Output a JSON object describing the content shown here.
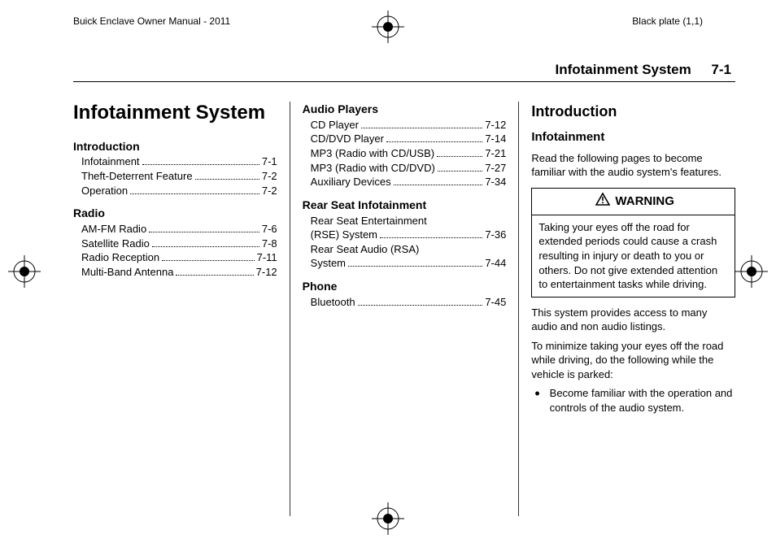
{
  "header": {
    "manual": "Buick Enclave Owner Manual - 2011",
    "plate": "Black plate (1,1)"
  },
  "section_header": {
    "title": "Infotainment System",
    "num": "7-1"
  },
  "chapter_title": "Infotainment System",
  "toc_col1": [
    {
      "title": "Introduction",
      "items": [
        {
          "label": "Infotainment",
          "page": "7-1"
        },
        {
          "label": "Theft-Deterrent Feature",
          "page": "7-2"
        },
        {
          "label": "Operation",
          "page": "7-2"
        }
      ]
    },
    {
      "title": "Radio",
      "items": [
        {
          "label": "AM-FM Radio",
          "page": "7-6"
        },
        {
          "label": "Satellite Radio",
          "page": "7-8"
        },
        {
          "label": "Radio Reception",
          "page": "7-11"
        },
        {
          "label": "Multi-Band Antenna",
          "page": "7-12"
        }
      ]
    }
  ],
  "toc_col2": [
    {
      "title": "Audio Players",
      "items": [
        {
          "label": "CD Player",
          "page": "7-12"
        },
        {
          "label": "CD/DVD Player",
          "page": "7-14"
        },
        {
          "label": "MP3 (Radio with CD/USB)",
          "page": "7-21"
        },
        {
          "label": "MP3 (Radio with CD/DVD)",
          "page": "7-27"
        },
        {
          "label": "Auxiliary Devices",
          "page": "7-34"
        }
      ]
    },
    {
      "title": "Rear Seat Infotainment",
      "items": [
        {
          "label": "Rear Seat Entertainment (RSE) System",
          "page": "7-36",
          "multiline": true
        },
        {
          "label": "Rear Seat Audio (RSA) System",
          "page": "7-44",
          "multiline": true
        }
      ]
    },
    {
      "title": "Phone",
      "items": [
        {
          "label": "Bluetooth",
          "page": "7-45"
        }
      ]
    }
  ],
  "intro": {
    "heading": "Introduction",
    "subheading": "Infotainment",
    "lead": "Read the following pages to become familiar with the audio system's features.",
    "warning_label": "WARNING",
    "warning_body": "Taking your eyes off the road for extended periods could cause a crash resulting in injury or death to you or others. Do not give extended attention to entertainment tasks while driving.",
    "para2": "This system provides access to many audio and non audio listings.",
    "para3": "To minimize taking your eyes off the road while driving, do the following while the vehicle is parked:",
    "bullet1": "Become familiar with the operation and controls of the audio system."
  }
}
